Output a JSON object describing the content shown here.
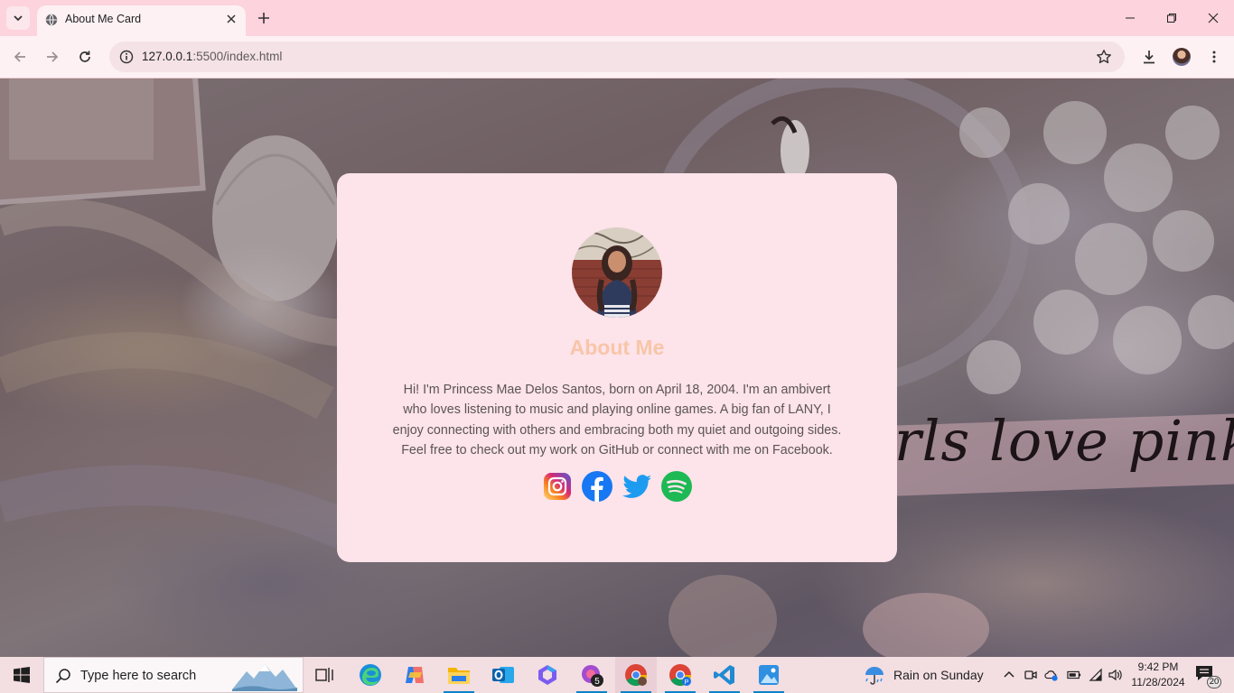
{
  "browser": {
    "tab_title": "About Me Card",
    "url_host": "127.0.0.1",
    "url_rest": ":5500/index.html"
  },
  "page": {
    "background_text": "rls love pink.",
    "card": {
      "title": "About Me",
      "bio": "Hi! I'm Princess Mae Delos Santos, born on April 18, 2004. I'm an ambivert who loves listening to music and playing online games. A big fan of LANY, I enjoy connecting with others and embracing both my quiet and outgoing sides. Feel free to check out my work on GitHub or connect with me on Facebook.",
      "socials": [
        "instagram-icon",
        "facebook-icon",
        "twitter-icon",
        "spotify-icon"
      ]
    },
    "colors": {
      "card_bg": "#fde3ea",
      "title": "#f7c6a9",
      "facebook": "#1877f2",
      "twitter": "#1d9bf0",
      "spotify": "#1db954"
    }
  },
  "taskbar": {
    "search_placeholder": "Type here to search",
    "weather_text": "Rain on Sunday",
    "time": "9:42 PM",
    "date": "11/28/2024",
    "notification_count": "20",
    "copilot_badge": "5"
  }
}
